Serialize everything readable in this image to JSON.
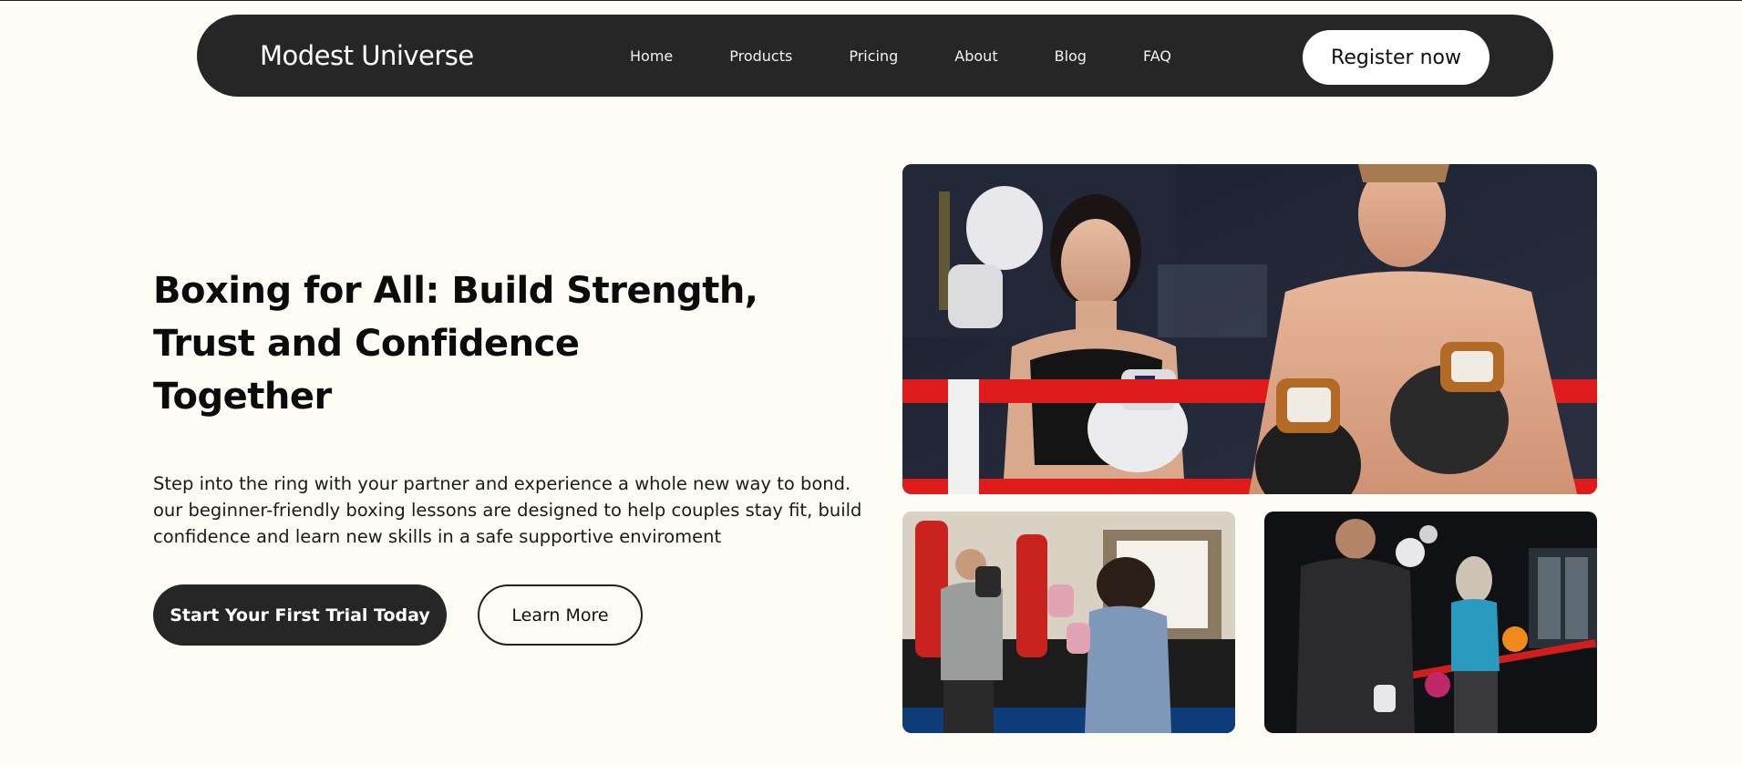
{
  "nav": {
    "brand": "Modest Universe",
    "links": [
      "Home",
      "Products",
      "Pricing",
      "About",
      "Blog",
      "FAQ"
    ],
    "register_label": "Register now"
  },
  "hero": {
    "title_lines": [
      "Boxing for All: Build Strength,",
      "Trust and Confidence",
      "Together"
    ],
    "description": "Step into the ring with your partner and experience a whole new way to bond. our beginner-friendly boxing lessons are designed to help couples stay fit, build confidence and learn new skills in a safe supportive enviroment",
    "primary_cta": "Start Your First Trial Today",
    "secondary_cta": "Learn More"
  },
  "colors": {
    "background": "#fdfdf6",
    "nav_background": "#262626",
    "ring_rope": "#e01b1b"
  }
}
